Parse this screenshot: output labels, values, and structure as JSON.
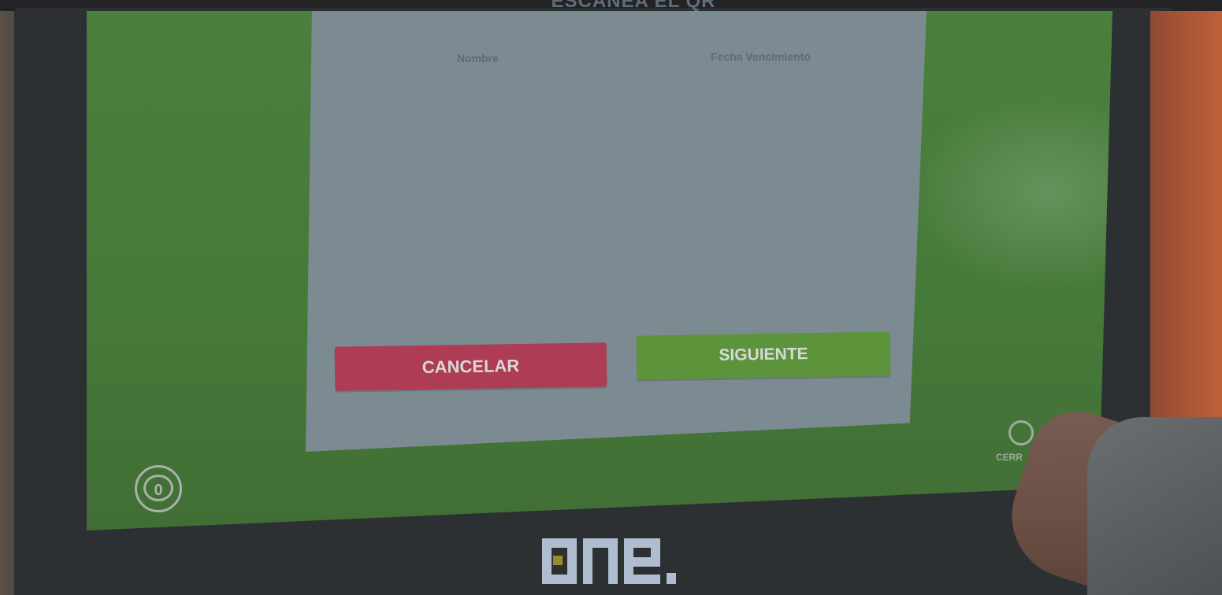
{
  "dialog": {
    "title": "ESCANEA EL QR",
    "columns": [
      "Nombre",
      "Fecha Vencimiento"
    ],
    "cancel_label": "CANCELAR",
    "next_label": "SIGUIENTE"
  },
  "cart": {
    "count": "0"
  },
  "close": {
    "label": "CERR"
  },
  "brand": {
    "logo_text": "one."
  },
  "colors": {
    "screen_background": "#467a3a",
    "dialog_background": "#7c8b91",
    "cancel_button": "#ad3c54",
    "next_button": "#5c933b",
    "bezel": "#2d3033",
    "logo": "#aebdd0"
  },
  "icons": {
    "cart": "circle-counter-icon",
    "close": "close-circle-icon",
    "brand": "one-logo"
  }
}
